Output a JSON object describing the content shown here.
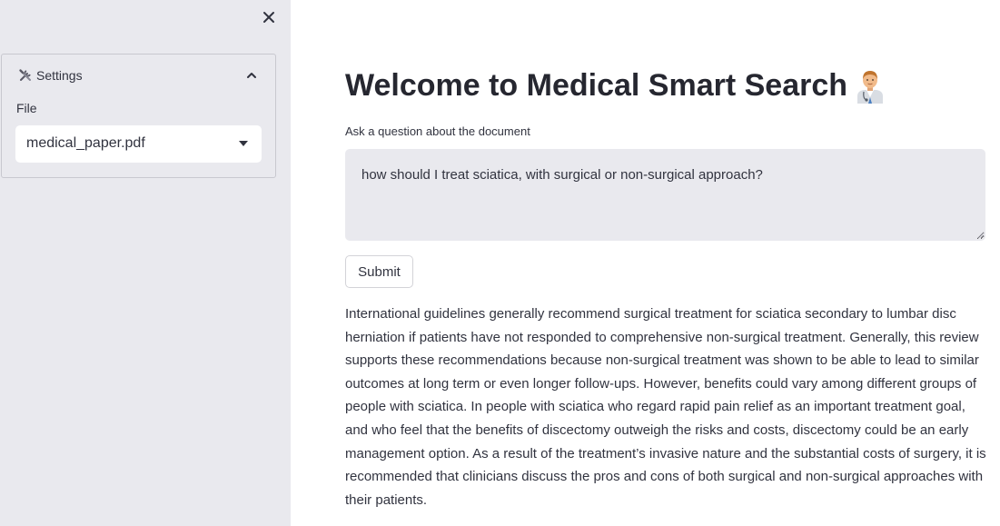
{
  "sidebar": {
    "close_icon": "close-icon",
    "expander": {
      "icon": "tools-icon",
      "title": "Settings",
      "chevron_icon": "chevron-up-icon",
      "file_label": "File",
      "file_select": {
        "value": "medical_paper.pdf",
        "caret_icon": "caret-down-icon"
      }
    }
  },
  "main": {
    "title": "Welcome to Medical Smart Search",
    "title_icon": "doctor-emoji-icon",
    "question_label": "Ask a question about the document",
    "question_value": "how should I treat sciatica, with surgical or non-surgical approach?",
    "submit_label": "Submit",
    "answer": "International guidelines generally recommend surgical treatment for sciatica secondary to lumbar disc herniation if patients have not responded to comprehensive non-surgical treatment. Generally, this review supports these recommendations because non-surgical treatment was shown to be able to lead to similar outcomes at long term or even longer follow-ups. However, benefits could vary among different groups of people with sciatica. In people with sciatica who regard rapid pain relief as an important treatment goal, and who feel that the benefits of discectomy outweigh the risks and costs, discectomy could be an early management option. As a result of the treatment’s invasive nature and the substantial costs of surgery, it is recommended that clinicians discuss the pros and cons of both surgical and non-surgical approaches with their patients."
  },
  "colors": {
    "sidebar_bg": "#e9e9ee",
    "text": "#31333f",
    "title": "#262730",
    "input_bg": "#e9e9ee"
  }
}
